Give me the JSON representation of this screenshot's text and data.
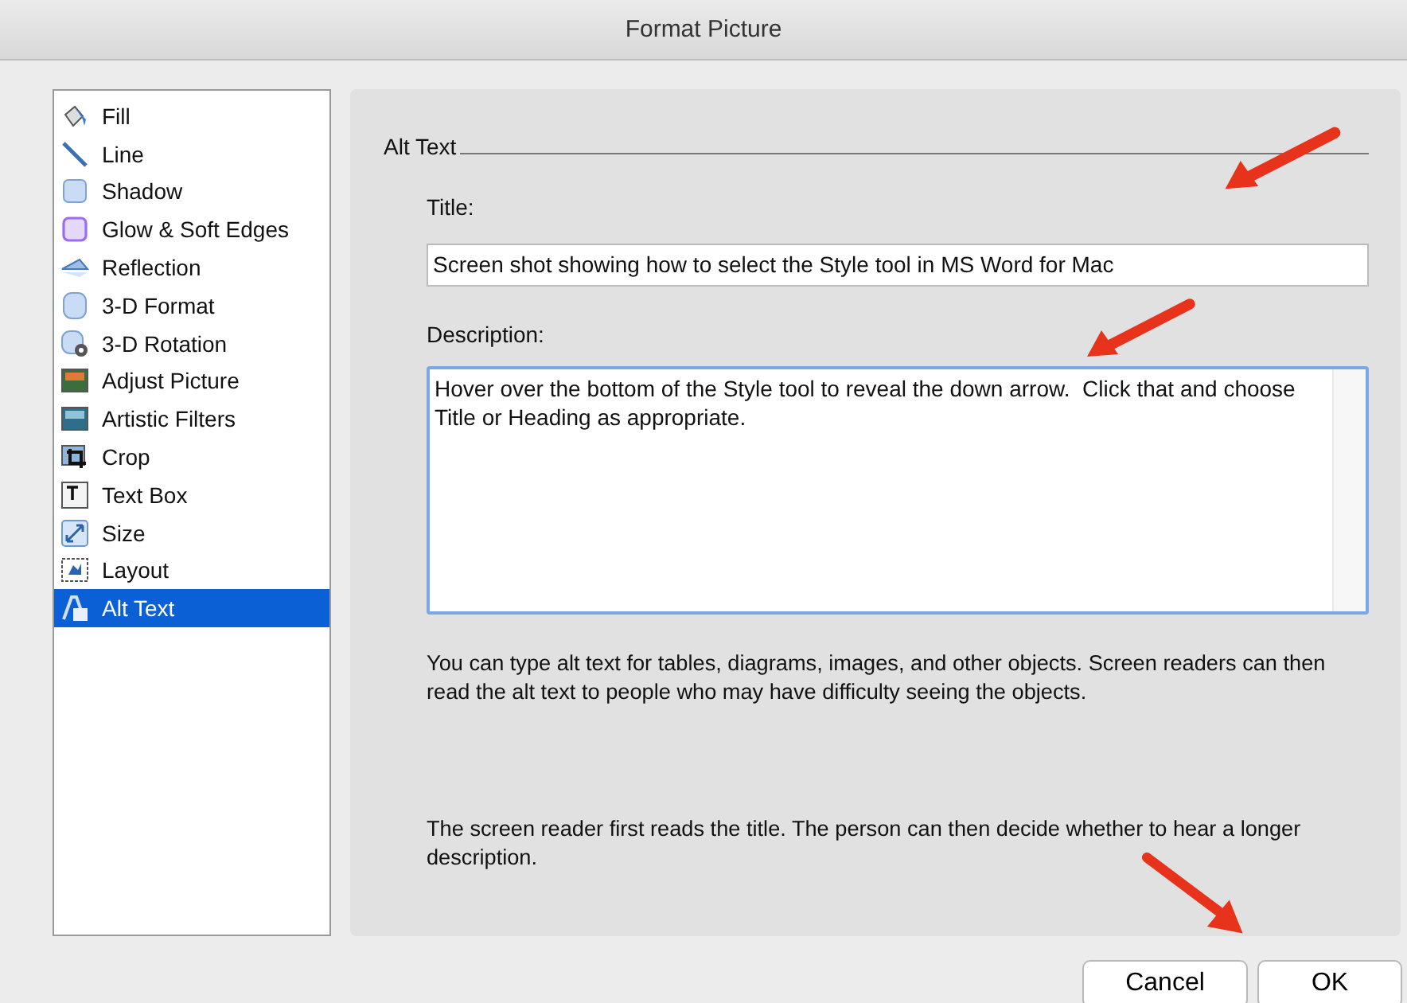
{
  "window": {
    "title": "Format Picture"
  },
  "sidebar": {
    "items": [
      {
        "label": "Fill",
        "selected": false
      },
      {
        "label": "Line",
        "selected": false
      },
      {
        "label": "Shadow",
        "selected": false
      },
      {
        "label": "Glow & Soft Edges",
        "selected": false
      },
      {
        "label": "Reflection",
        "selected": false
      },
      {
        "label": "3-D Format",
        "selected": false
      },
      {
        "label": "3-D Rotation",
        "selected": false
      },
      {
        "label": "Adjust Picture",
        "selected": false
      },
      {
        "label": "Artistic Filters",
        "selected": false
      },
      {
        "label": "Crop",
        "selected": false
      },
      {
        "label": "Text Box",
        "selected": false
      },
      {
        "label": "Size",
        "selected": false
      },
      {
        "label": "Layout",
        "selected": false
      },
      {
        "label": "Alt Text",
        "selected": true
      }
    ]
  },
  "panel": {
    "section_title": "Alt Text",
    "title_label": "Title:",
    "title_value": "Screen shot showing how to select the Style tool in MS Word for Mac",
    "description_label": "Description:",
    "description_value": "Hover over the bottom of the Style tool to reveal the down arrow.  Click that and choose Title or Heading as appropriate.",
    "help_texts": [
      "You can type alt text for tables, diagrams, images, and other objects. Screen readers can then read the alt text to people who may have difficulty seeing the objects.",
      "The screen reader first reads the title. The person can then decide whether to hear a longer description."
    ]
  },
  "buttons": [
    "Cancel",
    "OK"
  ]
}
